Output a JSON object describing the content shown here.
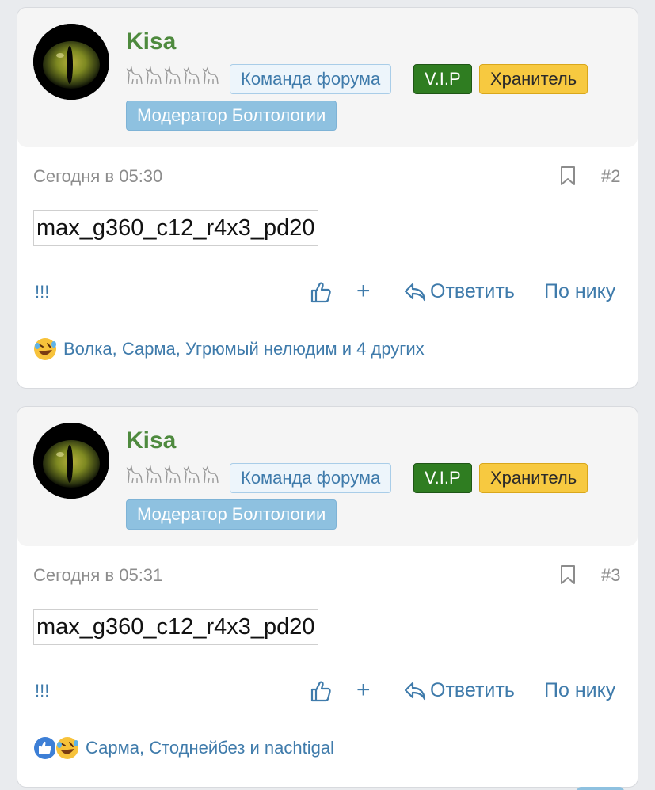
{
  "posts": [
    {
      "author": "Kisa",
      "badges": {
        "team": "Команда форума",
        "vip": "V.I.P",
        "keeper": "Хранитель",
        "moder": "Модератор Болтологии"
      },
      "date": "Сегодня в 05:30",
      "number": "#2",
      "content": "max_g360_c12_r4x3_pd20",
      "signature": "!!!",
      "actions": {
        "plus": "+",
        "reply": "Ответить",
        "by_nick": "По нику"
      },
      "reactions": {
        "icons": [
          "rofl-emoji-icon"
        ],
        "names": "Волка, Сарма, Угрюмый нелюдим и 4 других"
      }
    },
    {
      "author": "Kisa",
      "badges": {
        "team": "Команда форума",
        "vip": "V.I.P",
        "keeper": "Хранитель",
        "moder": "Модератор Болтологии"
      },
      "date": "Сегодня в 05:31",
      "number": "#3",
      "content": "max_g360_c12_r4x3_pd20",
      "signature": "!!!",
      "actions": {
        "plus": "+",
        "reply": "Ответить",
        "by_nick": "По нику"
      },
      "reactions": {
        "icons": [
          "like-reaction-icon",
          "rofl-emoji-icon"
        ],
        "names": "Сарма, Стоднейбез и nachtigal"
      }
    }
  ],
  "colors": {
    "username": "#4e8a3e",
    "link": "#3f7bab",
    "vip_badge": "#2f7d21",
    "keeper_badge": "#f7c940",
    "moder_badge": "#8ec1e0",
    "team_badge_bg": "#edf5fb",
    "muted_text": "#8c8c8c"
  }
}
